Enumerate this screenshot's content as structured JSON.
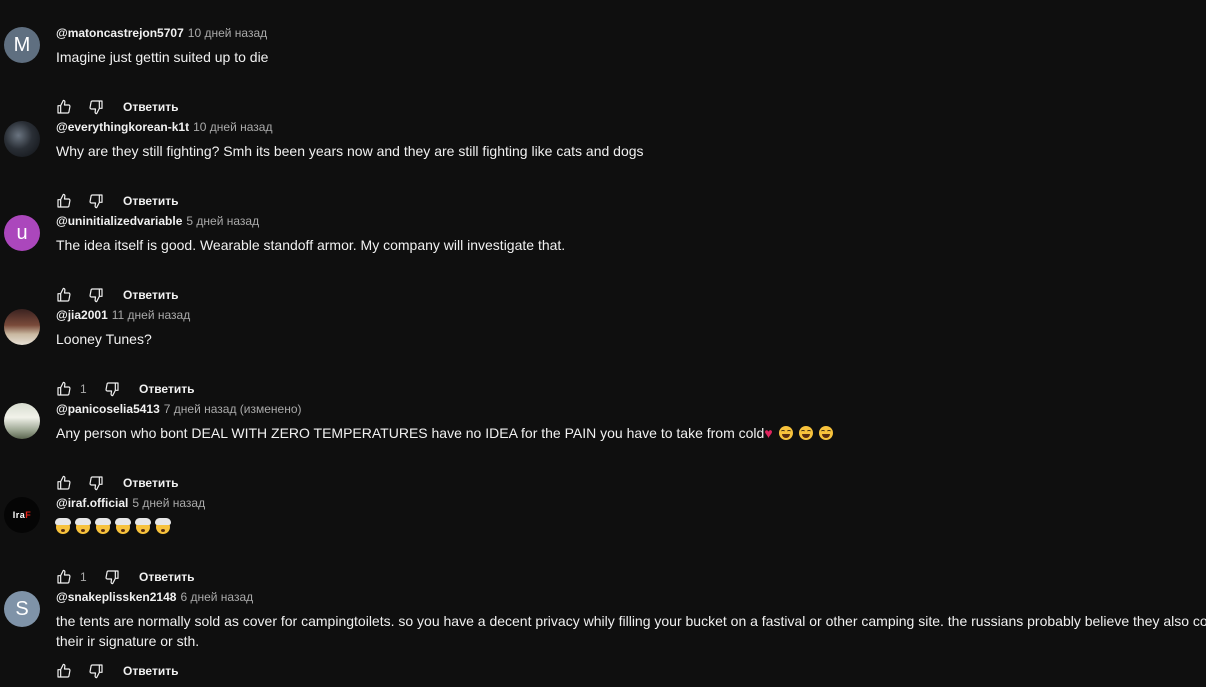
{
  "comments": [
    {
      "avatar_letter": "M",
      "avatar_color": "#5f6f80",
      "avatar_style": "letter",
      "author": "@matoncastrejon5707",
      "time": "10 дней назад",
      "lines": [
        "Imagine just gettin suited up to die"
      ],
      "like_count": "",
      "reply_label": "Ответить"
    },
    {
      "avatar_letter": "",
      "avatar_color": "#1e2228",
      "avatar_style": "photo-dark",
      "author": "@everythingkorean-k1t",
      "time": "10 дней назад",
      "lines": [
        "Why are they still fighting? Smh its been years now and they are still fighting like cats and dogs"
      ],
      "like_count": "",
      "reply_label": "Ответить"
    },
    {
      "avatar_letter": "u",
      "avatar_color": "#ab47bc",
      "avatar_style": "letter",
      "author": "@uninitializedvariable",
      "time": "5 дней назад",
      "lines": [
        "The idea itself is good. Wearable standoff armor. My company will investigate that."
      ],
      "like_count": "",
      "reply_label": "Ответить"
    },
    {
      "avatar_letter": "",
      "avatar_color": "#7a4a3a",
      "avatar_style": "photo-warm",
      "author": "@jia2001",
      "time": "11 дней назад",
      "lines": [
        "Looney Tunes?"
      ],
      "like_count": "1",
      "reply_label": "Ответить"
    },
    {
      "avatar_letter": "",
      "avatar_color": "#d7dccf",
      "avatar_style": "photo-light",
      "author": "@panicoselia5413",
      "time": "7 дней назад (изменено)",
      "lines": [
        "Any person who bont DEAL WITH ZERO TEMPERATURES have no IDEA for the PAIN you have to take from cold"
      ],
      "trailing_emoji": [
        "heart",
        "joy",
        "joy",
        "joy"
      ],
      "like_count": "",
      "reply_label": "Ответить"
    },
    {
      "avatar_letter": "Ira",
      "avatar_letter_accent": "F",
      "avatar_color": "#050505",
      "avatar_style": "logo",
      "author": "@iraf.official",
      "time": "5 дней назад",
      "lines": [
        ""
      ],
      "trailing_emoji": [
        "blown",
        "blown",
        "blown",
        "blown",
        "blown",
        "blown"
      ],
      "like_count": "1",
      "reply_label": "Ответить"
    },
    {
      "avatar_letter": "S",
      "avatar_color": "#7f93a8",
      "avatar_style": "letter",
      "author": "@snakeplissken2148",
      "time": "6 дней назад",
      "lines": [
        "the tents are normally sold as cover for campingtoilets. so you have a decent privacy whily filling your bucket on a fastival or other camping site. the russians probably believe they also co",
        "their ir signature or sth."
      ],
      "like_count": "",
      "reply_label": "Ответить"
    }
  ],
  "icons": {
    "like": "thumb-up-icon",
    "dislike": "thumb-down-icon"
  }
}
